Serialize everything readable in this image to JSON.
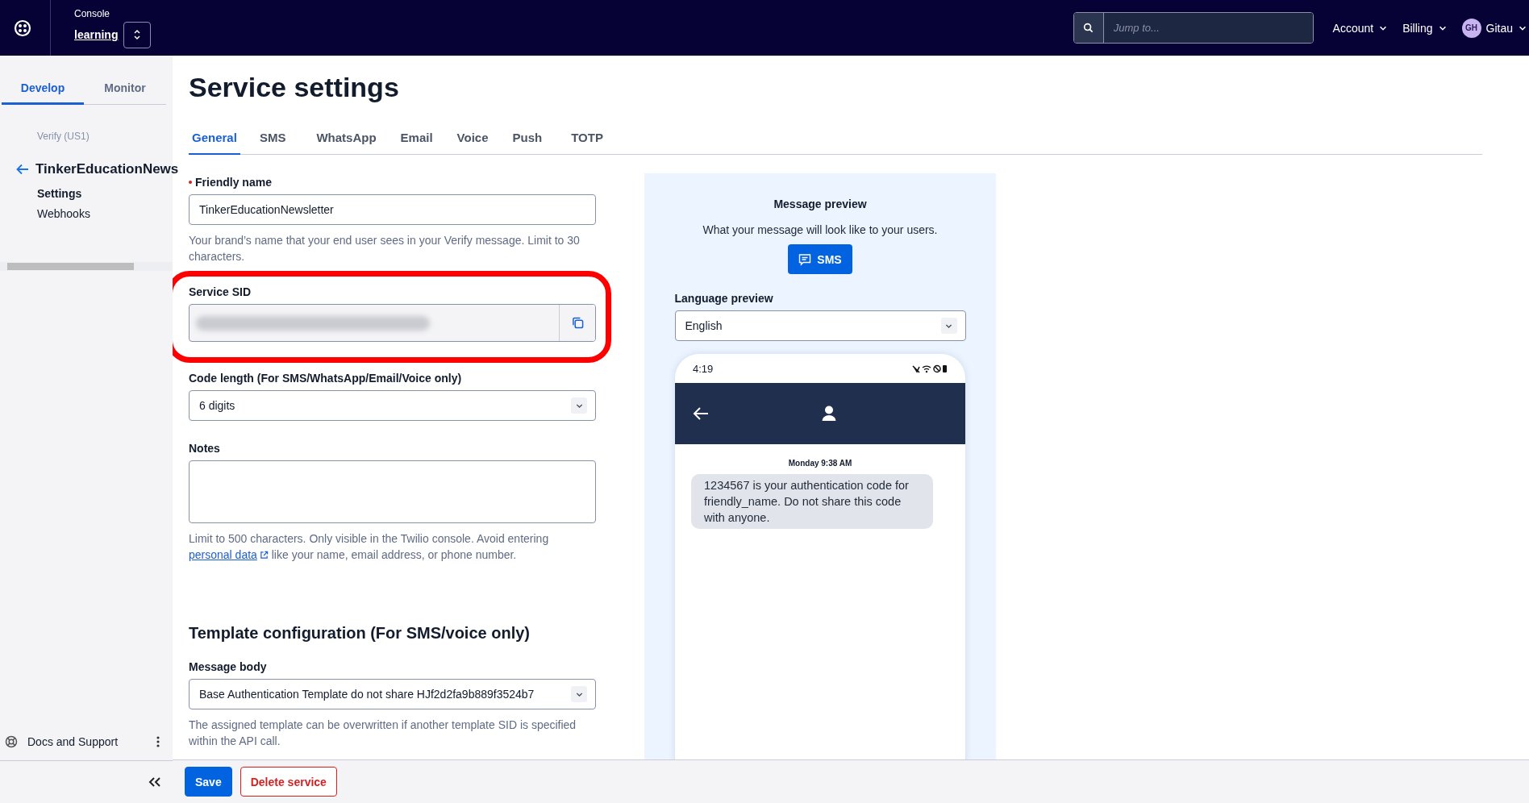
{
  "top_bar": {
    "context_label": "Console",
    "account_name": "learning",
    "search": {
      "placeholder": "Jump to..."
    },
    "menus": [
      {
        "label": "Account"
      },
      {
        "label": "Billing"
      }
    ],
    "user": {
      "initials": "GH",
      "name": "Gitau"
    }
  },
  "sidebar": {
    "tabs": [
      {
        "label": "Develop",
        "selected": true
      },
      {
        "label": "Monitor",
        "selected": false
      }
    ],
    "section": "Verify (US1)",
    "service_name": "TinkerEducationNews",
    "items": [
      {
        "label": "Settings",
        "selected": true
      },
      {
        "label": "Webhooks",
        "selected": false
      }
    ],
    "footer": {
      "label": "Docs and Support"
    }
  },
  "page": {
    "title": "Service settings",
    "tabs": [
      {
        "label": "General",
        "selected": true
      },
      {
        "label": "SMS",
        "selected": false
      },
      {
        "label": "WhatsApp",
        "selected": false
      },
      {
        "label": "Email",
        "selected": false
      },
      {
        "label": "Voice",
        "selected": false
      },
      {
        "label": "Push",
        "selected": false
      },
      {
        "label": "TOTP",
        "selected": false
      }
    ],
    "fields": [
      {
        "kind": "text",
        "label": "Friendly name",
        "required": true,
        "value": "TinkerEducationNewsletter",
        "help": "Your brand’s name that your end user sees in your Verify message. Limit to 30 characters."
      },
      {
        "kind": "sid",
        "label": "Service SID",
        "required": false,
        "highlighted": true
      },
      {
        "kind": "select",
        "label": "Code length (For SMS/WhatsApp/Email/Voice only)",
        "required": false,
        "value": "6 digits"
      },
      {
        "kind": "textarea",
        "label": "Notes",
        "required": false,
        "help": "Limit to 500 characters. Only visible in the Twilio console. Avoid entering",
        "help_link": "personal data",
        "help_after": "like your name, email address, or phone number."
      }
    ],
    "template_section": {
      "heading": "Template configuration (For SMS/voice only)",
      "fields": [
        {
          "kind": "select",
          "label": "Message body",
          "required": false,
          "value": "Base Authentication Template do not share HJf2d2fa9b889f3524b7",
          "help": "The assigned template can be overwritten if another template SID is specified within the API call."
        }
      ]
    },
    "preview": {
      "title": "Message preview",
      "subtitle": "What your message will look like to your users.",
      "channel_button": "SMS",
      "language_label": "Language preview",
      "language_value": "English",
      "phone": {
        "time": "4:19",
        "date": "Monday 9:38 AM",
        "message": "1234567 is your authentication code for friendly_name. Do not share this code with anyone."
      }
    }
  },
  "action_bar": {
    "buttons": [
      {
        "label": "Save",
        "kind": "primary"
      },
      {
        "label": "Delete service",
        "kind": "danger"
      }
    ]
  }
}
